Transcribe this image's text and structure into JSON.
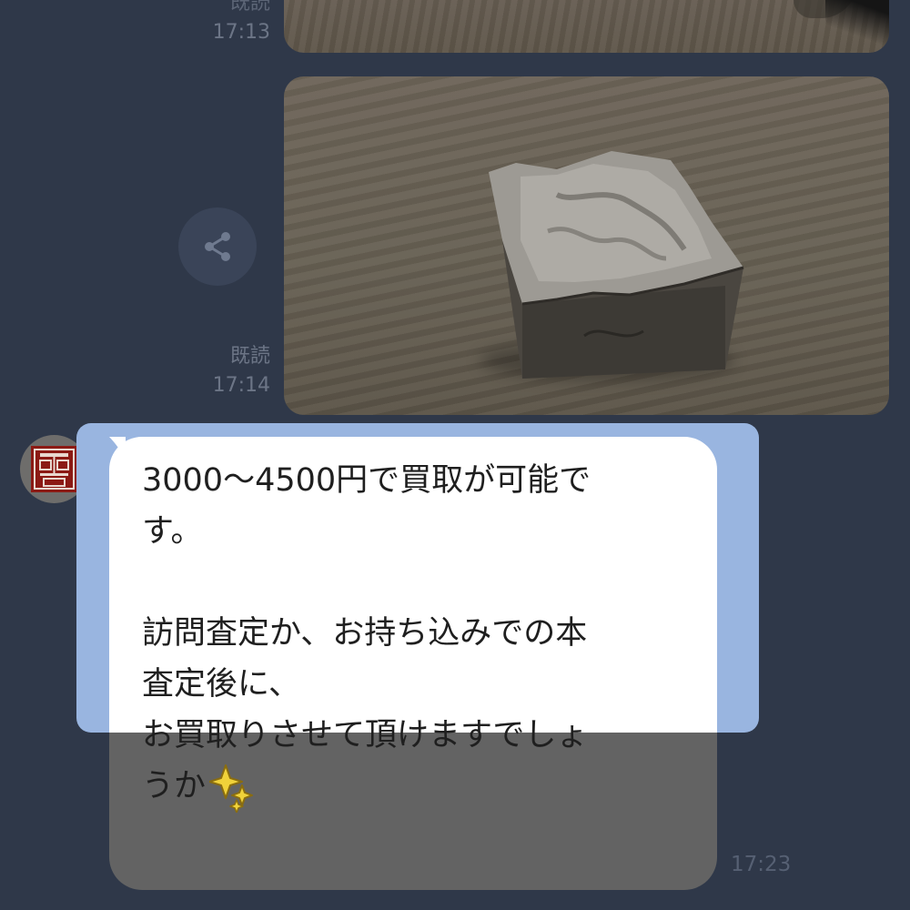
{
  "messages": {
    "outgoing": [
      {
        "read_label": "既読",
        "time": "17:13"
      },
      {
        "read_label": "既読",
        "time": "17:14"
      }
    ],
    "incoming": {
      "time": "17:23",
      "text_lines": [
        "3000〜4500円で買取が可能で",
        "す。",
        "",
        "訪問査定か、お持ち込みでの本",
        "査定後に、",
        "お買取りさせて頂けますでしょ",
        "うか"
      ],
      "emoji": "sparkles-icon"
    }
  },
  "icons": {
    "share": "share-icon",
    "avatar": "seal-logo"
  },
  "colors": {
    "background": "#2f3849",
    "highlight": "#99b5e0",
    "bubble_lit": "#ffffff",
    "bubble_dim": "#636363",
    "avatar_red": "#8b1a14"
  }
}
